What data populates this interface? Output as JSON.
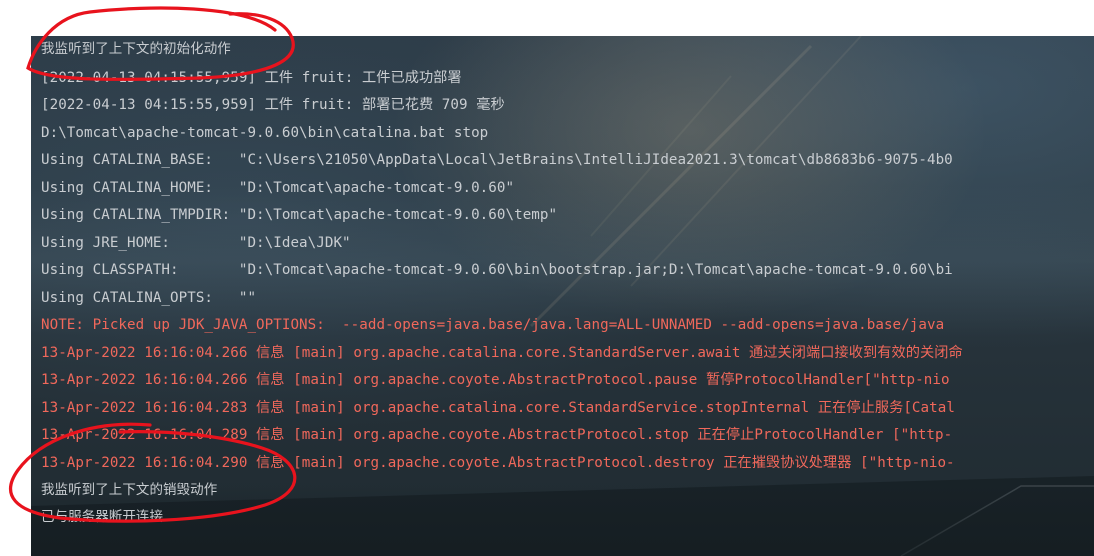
{
  "console": {
    "lines": [
      "我监听到了上下文的初始化动作",
      "[2022-04-13 04:15:55,959] 工件 fruit: 工件已成功部署",
      "[2022-04-13 04:15:55,959] 工件 fruit: 部署已花费 709 毫秒",
      "D:\\Tomcat\\apache-tomcat-9.0.60\\bin\\catalina.bat stop",
      "Using CATALINA_BASE:   \"C:\\Users\\21050\\AppData\\Local\\JetBrains\\IntelliJIdea2021.3\\tomcat\\db8683b6-9075-4b0",
      "Using CATALINA_HOME:   \"D:\\Tomcat\\apache-tomcat-9.0.60\"",
      "Using CATALINA_TMPDIR: \"D:\\Tomcat\\apache-tomcat-9.0.60\\temp\"",
      "Using JRE_HOME:        \"D:\\Idea\\JDK\"",
      "Using CLASSPATH:       \"D:\\Tomcat\\apache-tomcat-9.0.60\\bin\\bootstrap.jar;D:\\Tomcat\\apache-tomcat-9.0.60\\bi",
      "Using CATALINA_OPTS:   \"\"",
      "NOTE: Picked up JDK_JAVA_OPTIONS:  --add-opens=java.base/java.lang=ALL-UNNAMED --add-opens=java.base/java",
      "13-Apr-2022 16:16:04.266 信息 [main] org.apache.catalina.core.StandardServer.await 通过关闭端口接收到有效的关闭命",
      "13-Apr-2022 16:16:04.266 信息 [main] org.apache.coyote.AbstractProtocol.pause 暂停ProtocolHandler[\"http-nio",
      "13-Apr-2022 16:16:04.283 信息 [main] org.apache.catalina.core.StandardService.stopInternal 正在停止服务[Catal",
      "13-Apr-2022 16:16:04.289 信息 [main] org.apache.coyote.AbstractProtocol.stop 正在停止ProtocolHandler [\"http-",
      "13-Apr-2022 16:16:04.290 信息 [main] org.apache.coyote.AbstractProtocol.destroy 正在摧毁协议处理器 [\"http-nio-",
      "我监听到了上下文的销毁动作",
      "已与服务器断开连接"
    ]
  },
  "colors": {
    "normal_text": "#c9cdd1",
    "error_text": "#f0685b",
    "annotation": "#e8131d",
    "console_bg": "#2b3a44"
  }
}
